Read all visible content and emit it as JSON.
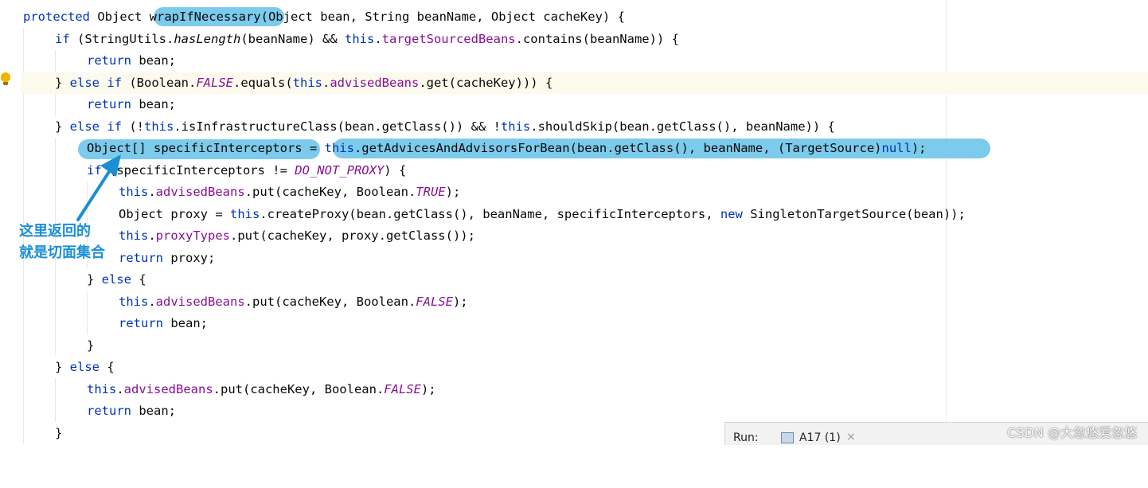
{
  "code": {
    "l1": {
      "a": "protected ",
      "b": "Object ",
      "method": "wrapIfNecessary",
      "c": "(Object bean, String beanName, Object cacheKey) {"
    },
    "l2": {
      "a": "if ",
      "b": "(StringUtils.",
      "c": "hasLength",
      "d": "(beanName) && ",
      "e": "this",
      "f": ".",
      "g": "targetSourcedBeans",
      "h": ".contains(beanName)) {"
    },
    "l3": {
      "a": "return ",
      "b": "bean;"
    },
    "l4": {
      "a": "} ",
      "b": "else if ",
      "c": "(Boolean.",
      "d": "FALSE",
      "e": ".equals(",
      "f": "this",
      "g": ".",
      "h": "advisedBeans",
      "i": ".get(cacheKey))) {"
    },
    "l5": {
      "a": "return ",
      "b": "bean;"
    },
    "l6": {
      "a": "} ",
      "b": "else if ",
      "c": "(!",
      "d": "this",
      "e": ".isInfrastructureClass(bean.getClass()) && !",
      "f": "this",
      "g": ".shouldSkip(bean.getClass(), beanName)) {"
    },
    "l7": {
      "a": "Object[] specificInterceptors",
      "b": " = ",
      "c": "this",
      "d": ".getAdvicesAndAdvisorsForBean(bean.getClass(), beanName, (TargetSource)",
      "e": "null",
      "f": ");"
    },
    "l8": {
      "a": "if ",
      "b": "(specificInterceptors != ",
      "c": "DO_NOT_PROXY",
      "d": ") {"
    },
    "l9": {
      "a": "this",
      "b": ".",
      "c": "advisedBeans",
      "d": ".put(cacheKey, Boolean.",
      "e": "TRUE",
      "f": ");"
    },
    "l10": {
      "a": "Object proxy = ",
      "b": "this",
      "c": ".createProxy(bean.getClass(), beanName, specificInterceptors, ",
      "d": "new ",
      "e": "SingletonTargetSource(bean));"
    },
    "l11": {
      "a": "this",
      "b": ".",
      "c": "proxyTypes",
      "d": ".put(cacheKey, proxy.getClass());"
    },
    "l12": {
      "a": "return ",
      "b": "proxy;"
    },
    "l13": {
      "a": "} ",
      "b": "else ",
      "c": "{"
    },
    "l14": {
      "a": "this",
      "b": ".",
      "c": "advisedBeans",
      "d": ".put(cacheKey, Boolean.",
      "e": "FALSE",
      "f": ");"
    },
    "l15": {
      "a": "return ",
      "b": "bean;"
    },
    "l16": {
      "a": "}"
    },
    "l17": {
      "a": "} ",
      "b": "else ",
      "c": "{"
    },
    "l18": {
      "a": "this",
      "b": ".",
      "c": "advisedBeans",
      "d": ".put(cacheKey, Boolean.",
      "e": "FALSE",
      "f": ");"
    },
    "l19": {
      "a": "return ",
      "b": "bean;"
    },
    "l20": {
      "a": "}"
    }
  },
  "annotation": {
    "line1": "这里返回的",
    "line2": "就是切面集合"
  },
  "run_bar": {
    "label": "Run:",
    "tab_label": "A17 (1)",
    "close_icon": "×"
  },
  "watermark": "CSDN @大忽悠爱忽悠",
  "icons": {
    "gutter": "lightbulb-icon",
    "annotation": "arrow-icon",
    "run_tab": "run-config-icon"
  },
  "colors": {
    "keyword": "#0033b3",
    "field": "#871094",
    "highlight_marker": "#75c8ec",
    "annotation_text": "#1a8fd6",
    "current_line": "#fcfaed"
  }
}
